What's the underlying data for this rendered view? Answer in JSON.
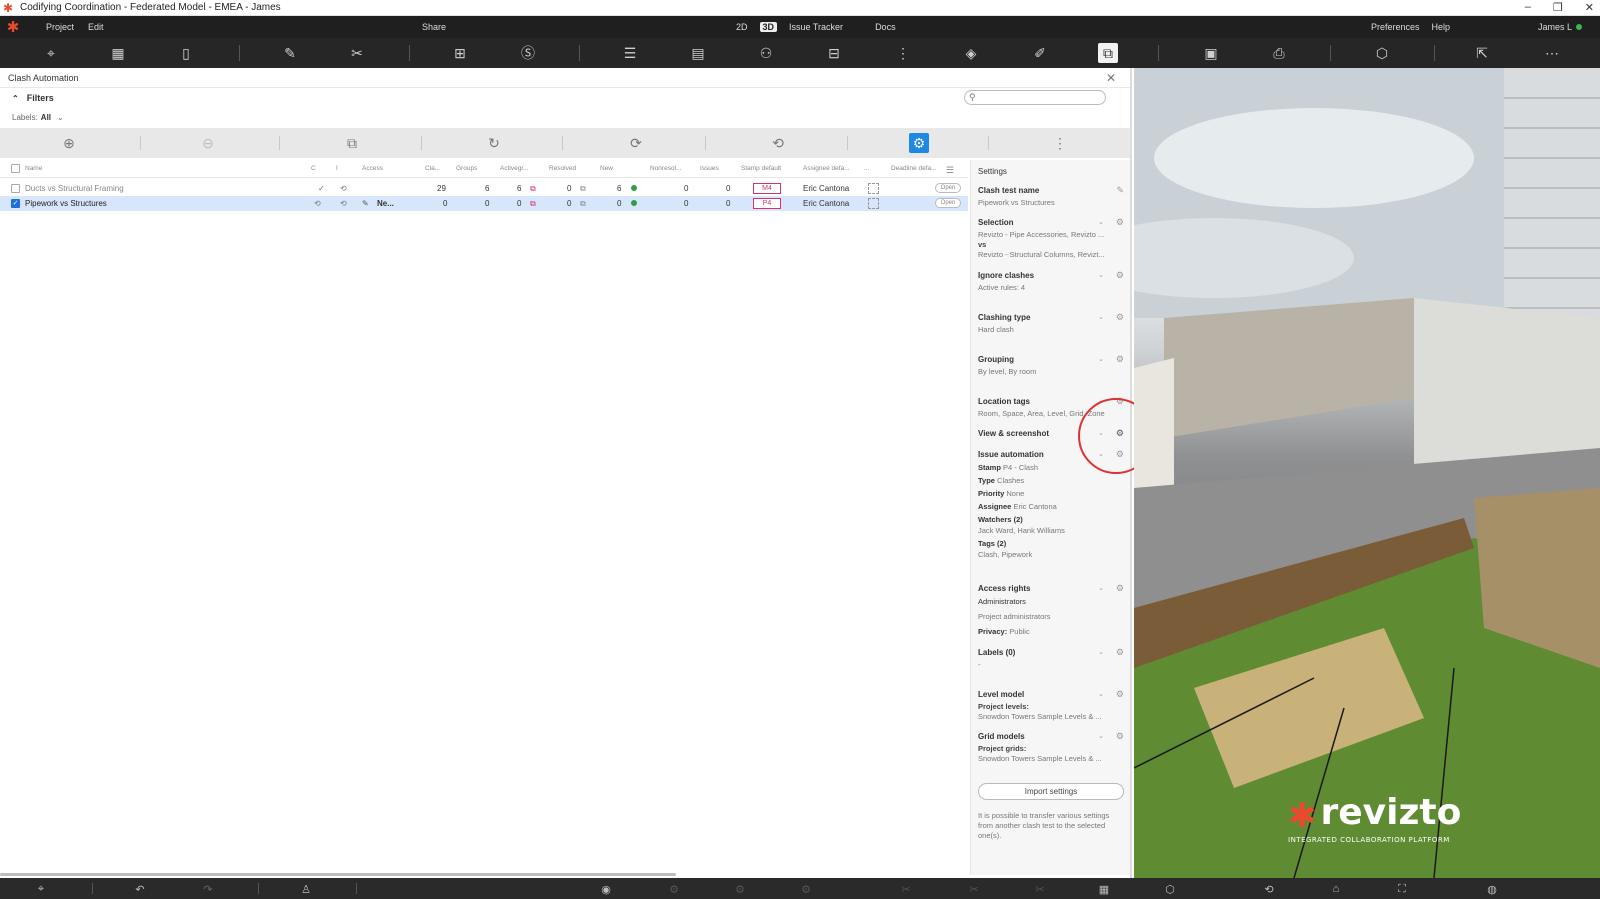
{
  "window": {
    "title": "Codifying Coordination - Federated Model - EMEA - James",
    "controls": [
      "–",
      "❐",
      "✕"
    ]
  },
  "menubar": {
    "items": [
      "Project",
      "Edit"
    ],
    "share": "Share",
    "mode_2d": "2D",
    "mode_3d": "3D",
    "issue_tracker": "Issue Tracker",
    "docs": "Docs",
    "preferences": "Preferences",
    "help": "Help",
    "user": "James L"
  },
  "panel": {
    "title": "Clash Automation",
    "filters_label": "Filters",
    "labels_prefix": "Labels:",
    "labels_value": "All"
  },
  "table": {
    "headers": [
      "Name",
      "C",
      "I",
      "Access",
      "Cla...",
      "Groups",
      "Activegr...",
      "Resolved",
      "New",
      "Nonresol...",
      "Issues",
      "Stamp default",
      "Assignee defa...",
      "...",
      "Deadline defa..."
    ],
    "rows": [
      {
        "name": "Ducts vs Structural Framing",
        "c": "✓",
        "access": "",
        "cla": "29",
        "groups": "6",
        "active": "6",
        "resolved": "0",
        "new": "6",
        "nonres": "0",
        "issues": "0",
        "stamp": "M4",
        "assignee": "Eric Cantona",
        "status": "Open",
        "selected": false
      },
      {
        "name": "Pipework vs Structures",
        "c": "",
        "access": "Ne...",
        "cla": "0",
        "groups": "0",
        "active": "0",
        "resolved": "0",
        "new": "0",
        "nonres": "0",
        "issues": "0",
        "stamp": "P4",
        "assignee": "Eric Cantona",
        "status": "Open",
        "selected": true
      }
    ]
  },
  "settings": {
    "title": "Settings",
    "clash_test_name_label": "Clash test name",
    "clash_test_name_value": "Pipework vs Structures",
    "selection_label": "Selection",
    "selection_line1": "Revizto - Pipe Accessories, Revizto ...",
    "selection_vs": "vs",
    "selection_line2": "Revizto - Structural Columns, Revizt...",
    "ignore_label": "Ignore clashes",
    "ignore_value": "Active rules: 4",
    "clashing_type_label": "Clashing type",
    "clashing_type_value": "Hard clash",
    "grouping_label": "Grouping",
    "grouping_value": "By level, By room",
    "location_label": "Location tags",
    "location_value": "Room, Space, Area, Level, Grid, Zone",
    "view_label": "View & screenshot",
    "issue_auto_label": "Issue automation",
    "stamp_k": "Stamp",
    "stamp_v": "P4 - Clash",
    "type_k": "Type",
    "type_v": "Clashes",
    "priority_k": "Priority",
    "priority_v": "None",
    "assignee_k": "Assignee",
    "assignee_v": "Eric Cantona",
    "watchers_k": "Watchers (2)",
    "watchers_v": "Jack Ward, Hank Williams",
    "tags_k": "Tags (2)",
    "tags_v": "Clash, Pipework",
    "access_label": "Access rights",
    "access_v1": "Administrators",
    "access_v2": "Project administrators",
    "privacy_k": "Privacy:",
    "privacy_v": "Public",
    "labels_label": "Labels (0)",
    "labels_value": "-",
    "level_label": "Level model",
    "level_sub": "Project levels:",
    "level_value": "Snowdon Towers Sample Levels & ...",
    "grid_label": "Grid models",
    "grid_sub": "Project grids:",
    "grid_value": "Snowdon Towers Sample Levels & ...",
    "import_button": "Import settings",
    "import_help": "It is possible to transfer various settings from another clash test to the selected one(s)."
  },
  "branding": {
    "word": "revizto",
    "tagline": "INTEGRATED COLLABORATION PLATFORM"
  },
  "colors": {
    "accent": "#1e88e5",
    "brand": "#e84a2e",
    "highlight": "#e03131",
    "stamp": "#d6336c"
  }
}
